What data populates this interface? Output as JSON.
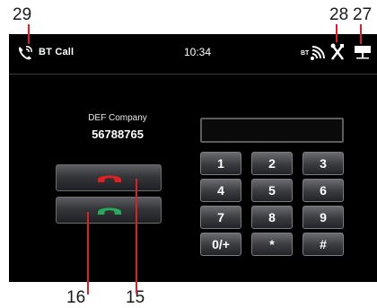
{
  "callouts": {
    "n29": "29",
    "n28": "28",
    "n27": "27",
    "n16": "16",
    "n15": "15"
  },
  "statusbar": {
    "title": "BT Call",
    "time": "10:34",
    "bt_label": "BT",
    "icons": [
      "bt-call-phone-icon",
      "bt-signal-icon",
      "tools-icon",
      "device-icon"
    ]
  },
  "contact": {
    "name": "DEF Company",
    "number": "56788765"
  },
  "call_buttons": {
    "hangup_icon": "hangup-phone-icon",
    "answer_icon": "answer-phone-icon",
    "hangup_color": "#e02020",
    "answer_color": "#2aa85a"
  },
  "keypad": {
    "display_value": "",
    "keys": [
      "1",
      "2",
      "3",
      "4",
      "5",
      "6",
      "7",
      "8",
      "9",
      "0/+",
      "*",
      "#"
    ]
  }
}
